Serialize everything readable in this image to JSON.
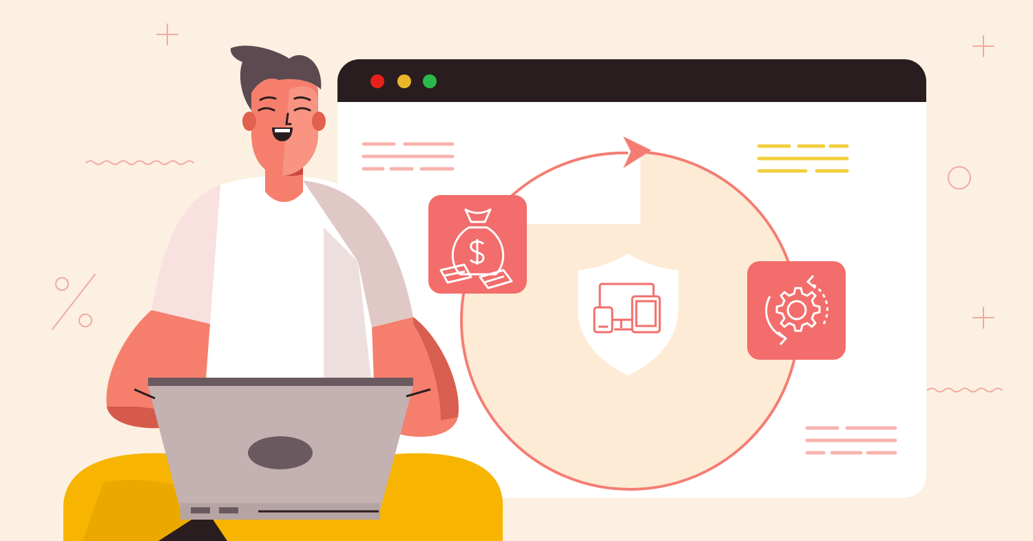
{
  "colors": {
    "background": "#fbf0e1",
    "window_bar": "#2a1d1f",
    "window_body": "#ffffff",
    "cycle_fill": "#fdebd6",
    "cycle_stroke": "#f47d73",
    "tile_coral": "#f26d6b",
    "text_line_pink": "#f7b3ad",
    "text_line_yellow": "#f2cf3b",
    "skin": "#f57f6c",
    "shirt": "#ffffff",
    "pants": "#f7b400",
    "laptop": "#c3b2b1",
    "hair": "#5c4a50"
  },
  "window": {
    "controls": [
      {
        "name": "close",
        "color": "#e8201c"
      },
      {
        "name": "minimize",
        "color": "#e8b82a"
      },
      {
        "name": "maximize",
        "color": "#2bba4a"
      }
    ]
  },
  "icons": {
    "money": "money-bag-icon",
    "center": "devices-shield-icon",
    "settings": "gear-sync-icon",
    "cycle_arrow": "cycle-arrow-icon"
  },
  "decorations": [
    "plus-icon",
    "circle-icon",
    "percent-icon",
    "wave-line"
  ]
}
